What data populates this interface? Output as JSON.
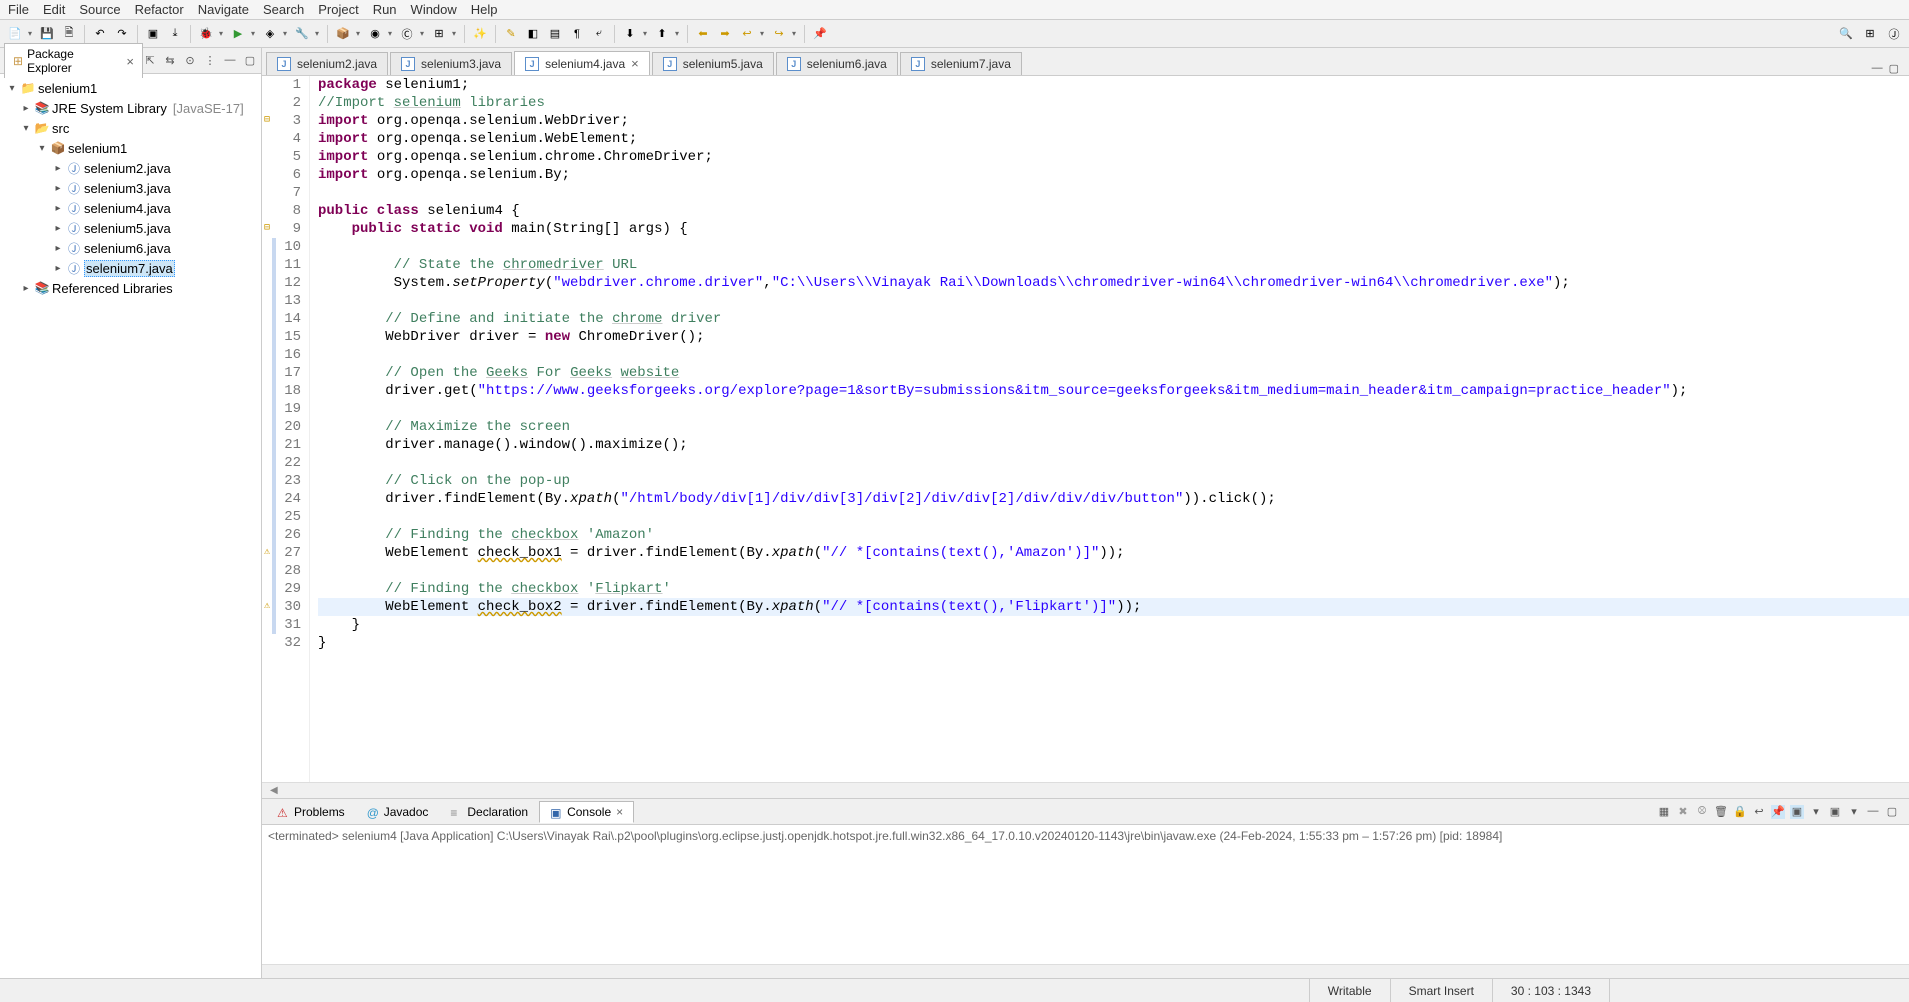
{
  "menu": {
    "items": [
      "File",
      "Edit",
      "Source",
      "Refactor",
      "Navigate",
      "Search",
      "Project",
      "Run",
      "Window",
      "Help"
    ]
  },
  "explorer": {
    "title": "Package Explorer",
    "tree": {
      "project": "selenium1",
      "jre": "JRE System Library",
      "jre_extra": "[JavaSE-17]",
      "src": "src",
      "pkg": "selenium1",
      "files": [
        "selenium2.java",
        "selenium3.java",
        "selenium4.java",
        "selenium5.java",
        "selenium6.java",
        "selenium7.java"
      ],
      "refs": "Referenced Libraries"
    }
  },
  "editor": {
    "tabs": [
      {
        "label": "selenium2.java",
        "active": false,
        "close": false
      },
      {
        "label": "selenium3.java",
        "active": false,
        "close": false
      },
      {
        "label": "selenium4.java",
        "active": true,
        "close": true
      },
      {
        "label": "selenium5.java",
        "active": false,
        "close": false
      },
      {
        "label": "selenium6.java",
        "active": false,
        "close": false
      },
      {
        "label": "selenium7.java",
        "active": false,
        "close": false
      }
    ],
    "line_numbers": [
      "1",
      "2",
      "3",
      "4",
      "5",
      "6",
      "7",
      "8",
      "9",
      "10",
      "11",
      "12",
      "13",
      "14",
      "15",
      "16",
      "17",
      "18",
      "19",
      "20",
      "21",
      "22",
      "23",
      "24",
      "25",
      "26",
      "27",
      "28",
      "29",
      "30",
      "31",
      "32"
    ],
    "markers": {
      "3": "expand",
      "9": "expand",
      "27": "warn",
      "30": "warn"
    },
    "change_lines": [
      10,
      11,
      12,
      13,
      14,
      15,
      16,
      17,
      18,
      19,
      20,
      21,
      22,
      23,
      24,
      25,
      26,
      27,
      28,
      29,
      30,
      31
    ],
    "current_line": 30
  },
  "code": {
    "l1_a": "package",
    "l1_b": " selenium1;",
    "l2": "//Import ",
    "l2_u": "selenium",
    "l2_b": " libraries",
    "l3_a": "import",
    "l3_b": " org.openqa.selenium.WebDriver;",
    "l4_a": "import",
    "l4_b": " org.openqa.selenium.WebElement;",
    "l5_a": "import",
    "l5_b": " org.openqa.selenium.chrome.ChromeDriver;",
    "l6_a": "import",
    "l6_b": " org.openqa.selenium.By;",
    "l8_a": "public class",
    "l8_b": " selenium4 {",
    "l9_a": "    public static void",
    "l9_b": " main(String[] args) {",
    "l11_a": "         // State the ",
    "l11_u": "chromedriver",
    "l11_b": " URL",
    "l12_a": "         System.",
    "l12_m": "setProperty",
    "l12_b": "(",
    "l12_s1": "\"webdriver.chrome.driver\"",
    "l12_c": ",",
    "l12_s2": "\"C:\\\\Users\\\\Vinayak Rai\\\\Downloads\\\\chromedriver-win64\\\\chromedriver-win64\\\\chromedriver.exe\"",
    "l12_d": ");",
    "l14_a": "        // Define and initiate the ",
    "l14_u": "chrome",
    "l14_b": " driver",
    "l15_a": "        WebDriver driver = ",
    "l15_k": "new",
    "l15_b": " ChromeDriver();",
    "l17_a": "        // Open the ",
    "l17_u1": "Geeks",
    "l17_m": " For ",
    "l17_u2": "Geeks",
    "l17_sp": " ",
    "l17_u3": "website",
    "l18_a": "        driver.get(",
    "l18_s": "\"https://www.geeksforgeeks.org/explore?page=1&sortBy=submissions&itm_source=geeksforgeeks&itm_medium=main_header&itm_campaign=practice_header\"",
    "l18_b": ");",
    "l20": "        // Maximize the screen",
    "l21": "        driver.manage().window().maximize();",
    "l23": "        // Click on the pop-up",
    "l24_a": "        driver.findElement(By.",
    "l24_m": "xpath",
    "l24_b": "(",
    "l24_s": "\"/html/body/div[1]/div/div[3]/div[2]/div/div[2]/div/div/div/button\"",
    "l24_c": ")).click();",
    "l26_a": "        // Finding the ",
    "l26_u": "checkbox",
    "l26_b": " 'Amazon'",
    "l27_a": "        WebElement ",
    "l27_v": "check_box1",
    "l27_b": " = driver.findElement(By.",
    "l27_m": "xpath",
    "l27_c": "(",
    "l27_s": "\"// *[contains(text(),'Amazon')]\"",
    "l27_d": "));",
    "l29_a": "        // Finding the ",
    "l29_u": "checkbox",
    "l29_b": " '",
    "l29_u2": "Flipkart",
    "l29_c": "'",
    "l30_a": "        WebElement ",
    "l30_v": "check_box2",
    "l30_b": " = driver.findElement(By.",
    "l30_m": "xpath",
    "l30_c": "(",
    "l30_s": "\"// *[contains(text(),'Flipkart')]\"",
    "l30_d": "));",
    "l31": "    }",
    "l32": "}"
  },
  "bottom": {
    "tabs": [
      {
        "label": "Problems",
        "icon": "⚠"
      },
      {
        "label": "Javadoc",
        "icon": "@"
      },
      {
        "label": "Declaration",
        "icon": "≡"
      },
      {
        "label": "Console",
        "icon": "▣"
      }
    ],
    "active_tab": 3,
    "console_line": "<terminated> selenium4 [Java Application] C:\\Users\\Vinayak Rai\\.p2\\pool\\plugins\\org.eclipse.justj.openjdk.hotspot.jre.full.win32.x86_64_17.0.10.v20240120-1143\\jre\\bin\\javaw.exe (24-Feb-2024, 1:55:33 pm – 1:57:26 pm) [pid: 18984]"
  },
  "status": {
    "writable": "Writable",
    "insert": "Smart Insert",
    "cursor": "30 : 103 : 1343"
  }
}
